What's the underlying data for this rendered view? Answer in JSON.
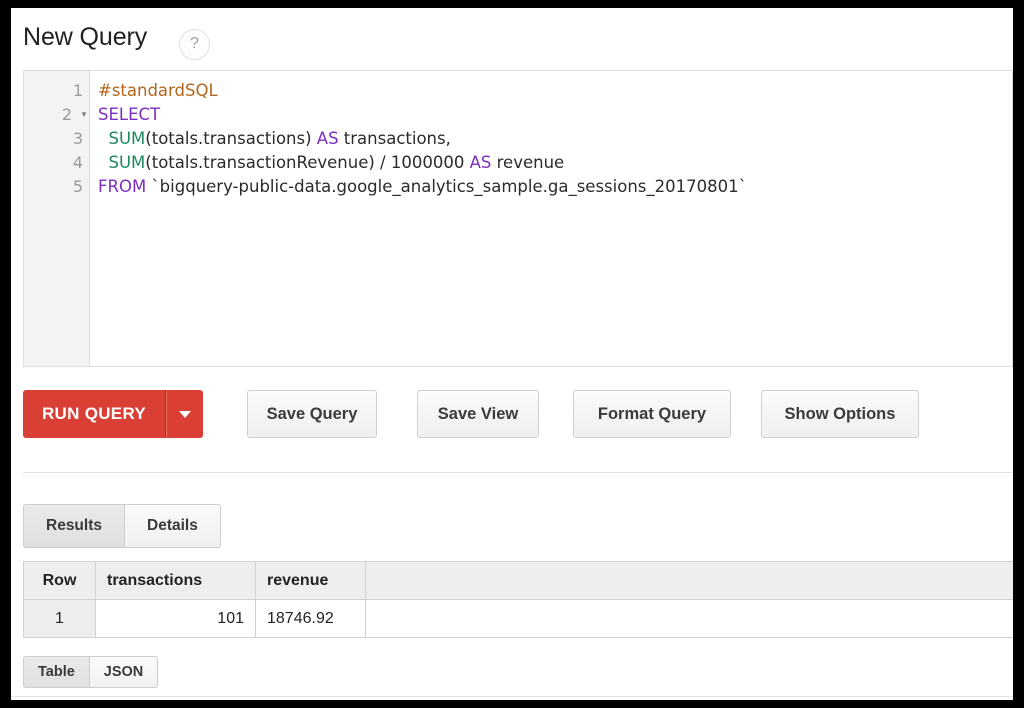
{
  "header": {
    "title": "New Query",
    "help_icon": "question-mark-icon",
    "help_label": "?"
  },
  "editor": {
    "line_numbers": [
      "1",
      "2",
      "3",
      "4",
      "5"
    ],
    "fold_line": "2",
    "fold_glyph": "▾",
    "lines": [
      {
        "n": "1",
        "tokens": [
          {
            "t": "comment",
            "s": "#standardSQL"
          }
        ]
      },
      {
        "n": "2",
        "tokens": [
          {
            "t": "keyword",
            "s": "SELECT"
          }
        ]
      },
      {
        "n": "3",
        "tokens": [
          {
            "t": "plain",
            "s": "  "
          },
          {
            "t": "func",
            "s": "SUM"
          },
          {
            "t": "plain",
            "s": "(totals.transactions) "
          },
          {
            "t": "keyword",
            "s": "AS"
          },
          {
            "t": "plain",
            "s": " transactions,"
          }
        ]
      },
      {
        "n": "4",
        "tokens": [
          {
            "t": "plain",
            "s": "  "
          },
          {
            "t": "func",
            "s": "SUM"
          },
          {
            "t": "plain",
            "s": "(totals.transactionRevenue) / "
          },
          {
            "t": "number",
            "s": "1000000"
          },
          {
            "t": "plain",
            "s": " "
          },
          {
            "t": "keyword",
            "s": "AS"
          },
          {
            "t": "plain",
            "s": " revenue"
          }
        ]
      },
      {
        "n": "5",
        "tokens": [
          {
            "t": "keyword",
            "s": "FROM"
          },
          {
            "t": "plain",
            "s": " `bigquery-public-data.google_analytics_sample.ga_sessions_20170801`"
          }
        ]
      }
    ],
    "plain_text": "#standardSQL\nSELECT\n  SUM(totals.transactions) AS transactions,\n  SUM(totals.transactionRevenue) / 1000000 AS revenue\nFROM `bigquery-public-data.google_analytics_sample.ga_sessions_20170801`"
  },
  "actions": {
    "run_query": "RUN QUERY",
    "run_query_dropdown": "caret-down-icon",
    "save_query": "Save Query",
    "save_view": "Save View",
    "format_query": "Format Query",
    "show_options": "Show Options",
    "run_query_color": "#d93f34"
  },
  "result_tabs": [
    {
      "label": "Results",
      "active": true
    },
    {
      "label": "Details",
      "active": false
    }
  ],
  "results_table": {
    "columns": [
      "Row",
      "transactions",
      "revenue",
      ""
    ],
    "rows": [
      {
        "row": "1",
        "transactions": "101",
        "revenue": "18746.92",
        "filler": ""
      }
    ]
  },
  "format_toggle": [
    {
      "label": "Table",
      "active": true
    },
    {
      "label": "JSON",
      "active": false
    }
  ]
}
